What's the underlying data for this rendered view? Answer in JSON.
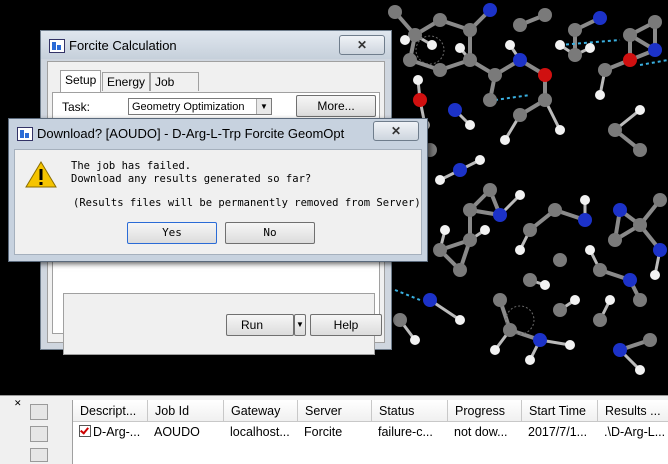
{
  "forcite": {
    "title": "Forcite Calculation",
    "close": "✕",
    "tabs": [
      "Setup",
      "Energy",
      "Job Control"
    ],
    "task_label": "Task:",
    "task_value": "Geometry Optimization",
    "more_button": "More...",
    "run_button": "Run",
    "help_button": "Help"
  },
  "dialog": {
    "title": "Download? [AOUDO] - D-Arg-L-Trp Forcite GeomOpt",
    "close": "✕",
    "line1": "The job has failed.",
    "line2": "Download any results generated so far?",
    "line3": "(Results files will be permanently removed from Server)",
    "yes": "Yes",
    "no": "No"
  },
  "jobs_table": {
    "columns": [
      "Descript...",
      "Job Id",
      "Gateway",
      "Server",
      "Status",
      "Progress",
      "Start Time",
      "Results ..."
    ],
    "rows": [
      [
        "D-Arg-...",
        "AOUDO",
        "localhost...",
        "Forcite",
        "failure-c...",
        "not dow...",
        "2017/7/1...",
        ".\\D-Arg-L..."
      ]
    ]
  },
  "colors": {
    "carbon": "#7a7a7a",
    "nitrogen": "#1c32c8",
    "oxygen": "#d01010",
    "hydrogen": "#f2f2f2",
    "hbond": "#3ab0e0",
    "warning": "#f5c400"
  }
}
